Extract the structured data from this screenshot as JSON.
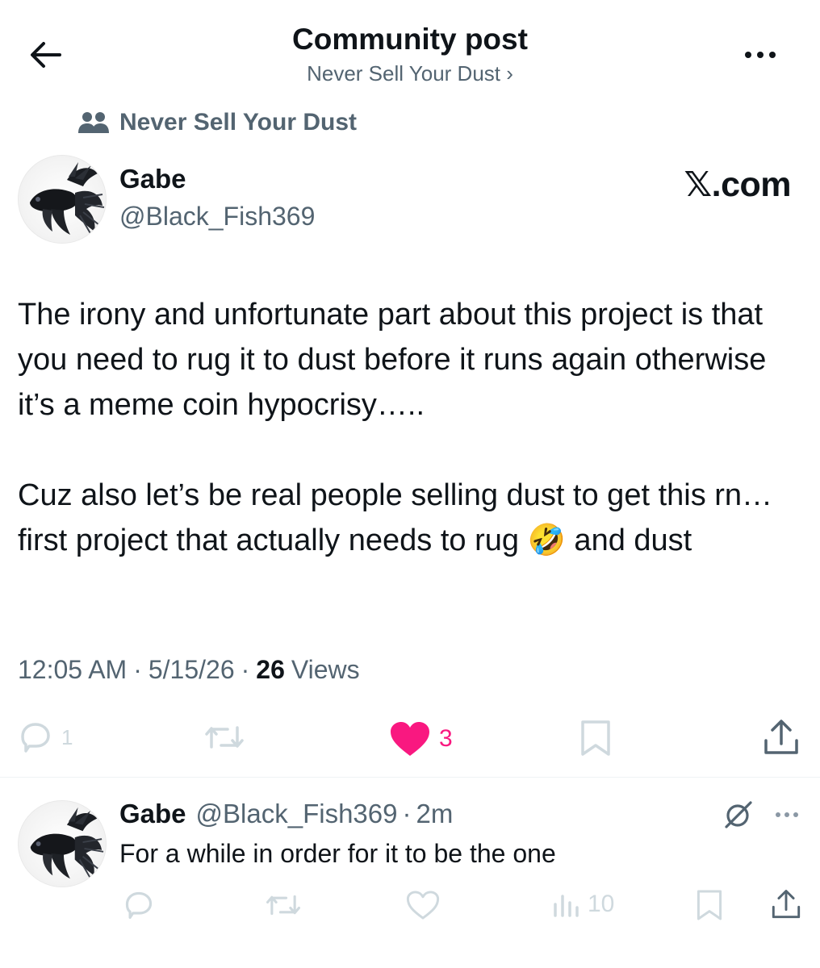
{
  "header": {
    "title": "Community post",
    "subtitle": "Never Sell Your Dust ›"
  },
  "community": {
    "label": "Never Sell Your Dust"
  },
  "post": {
    "author_name": "Gabe",
    "author_handle": "@Black_Fish369",
    "watermark": "𝕏.com",
    "paragraph1": "The irony and unfortunate part about this project is that you need to rug it to dust before it runs again otherwise it’s a meme coin hypocrisy…..",
    "paragraph2_a": "Cuz also let’s be real people selling dust to get this rn… first project that actually needs to rug ",
    "paragraph2_emoji": "🤣",
    "paragraph2_b": " and dust",
    "time": "12:05 AM",
    "date": "5/15/26",
    "views_count": "26",
    "views_label": "Views",
    "reply_count": "1",
    "like_count": "3"
  },
  "reply": {
    "author_name": "Gabe",
    "author_handle": "@Black_Fish369",
    "time": "2m",
    "text": "For a while in order for it to be the one",
    "views_count": "10"
  },
  "colors": {
    "like": "#f91880",
    "secondary_text": "#536471",
    "faded_icon": "#cfd9de"
  }
}
